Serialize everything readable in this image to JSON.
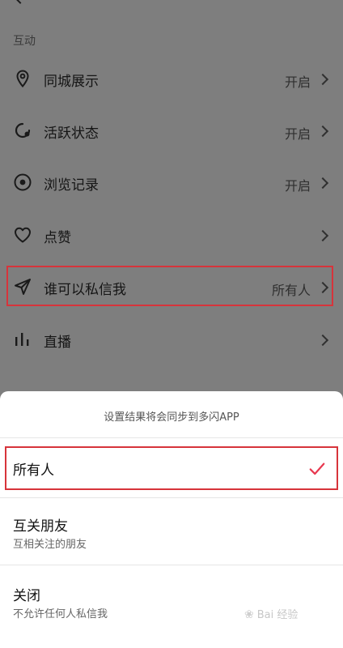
{
  "section": {
    "label": "互动"
  },
  "rows": [
    {
      "label": "同城展示",
      "value": "开启",
      "icon": "location-pin-icon"
    },
    {
      "label": "活跃状态",
      "value": "开启",
      "icon": "activity-status-icon"
    },
    {
      "label": "浏览记录",
      "value": "开启",
      "icon": "eye-icon"
    },
    {
      "label": "点赞",
      "value": "",
      "icon": "heart-icon"
    },
    {
      "label": "谁可以私信我",
      "value": "所有人",
      "icon": "send-icon"
    },
    {
      "label": "直播",
      "value": "",
      "icon": "bar-chart-icon"
    }
  ],
  "sheet": {
    "note": "设置结果将会同步到多闪APP",
    "options": [
      {
        "title": "所有人",
        "subtitle": "",
        "selected": true
      },
      {
        "title": "互关朋友",
        "subtitle": "互相关注的朋友",
        "selected": false
      },
      {
        "title": "关闭",
        "subtitle": "不允许任何人私信我",
        "selected": false
      }
    ]
  },
  "colors": {
    "highlight": "#d7343b",
    "check": "#e8384f"
  },
  "watermark": {
    "text": "Bai 经验"
  }
}
